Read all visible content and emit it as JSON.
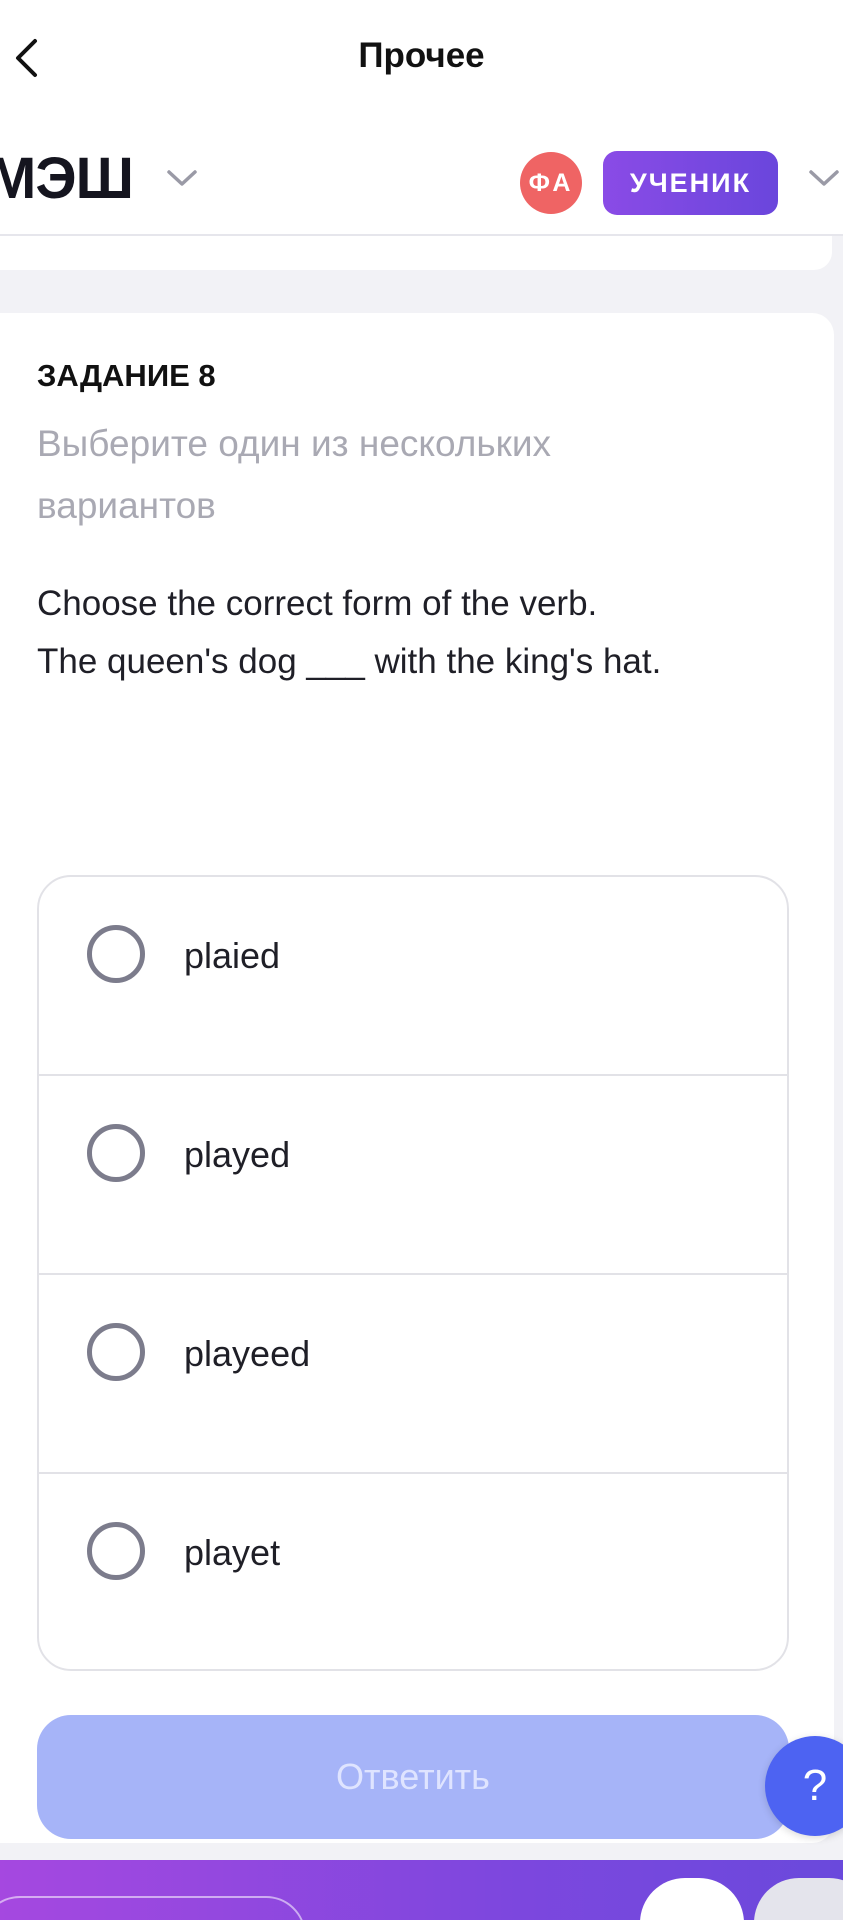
{
  "nav": {
    "title": "Прочее",
    "back_icon": "chevron-left-icon"
  },
  "header": {
    "brand": "МЭШ",
    "brand_menu_icon": "chevron-down-icon",
    "avatar_initials": "ФА",
    "avatar_color": "#ef6464",
    "role_label": "УЧЕНИК",
    "role_color": "#7a48e0",
    "profile_menu_icon": "chevron-down-icon"
  },
  "task": {
    "number_label": "ЗАДАНИЕ 8",
    "hint": "Выберите один из нескольких вариантов",
    "question_line1": "Choose the correct form of the verb.",
    "question_line2": "The queen's dog ___ with the king's hat.",
    "options": [
      {
        "label": "plaied",
        "selected": false
      },
      {
        "label": "played",
        "selected": false
      },
      {
        "label": "playeed",
        "selected": false
      },
      {
        "label": "playet",
        "selected": false
      }
    ],
    "submit_label": "Ответить",
    "submit_color": "#a6b4f8"
  },
  "help": {
    "label": "?",
    "color": "#4d63f2"
  }
}
